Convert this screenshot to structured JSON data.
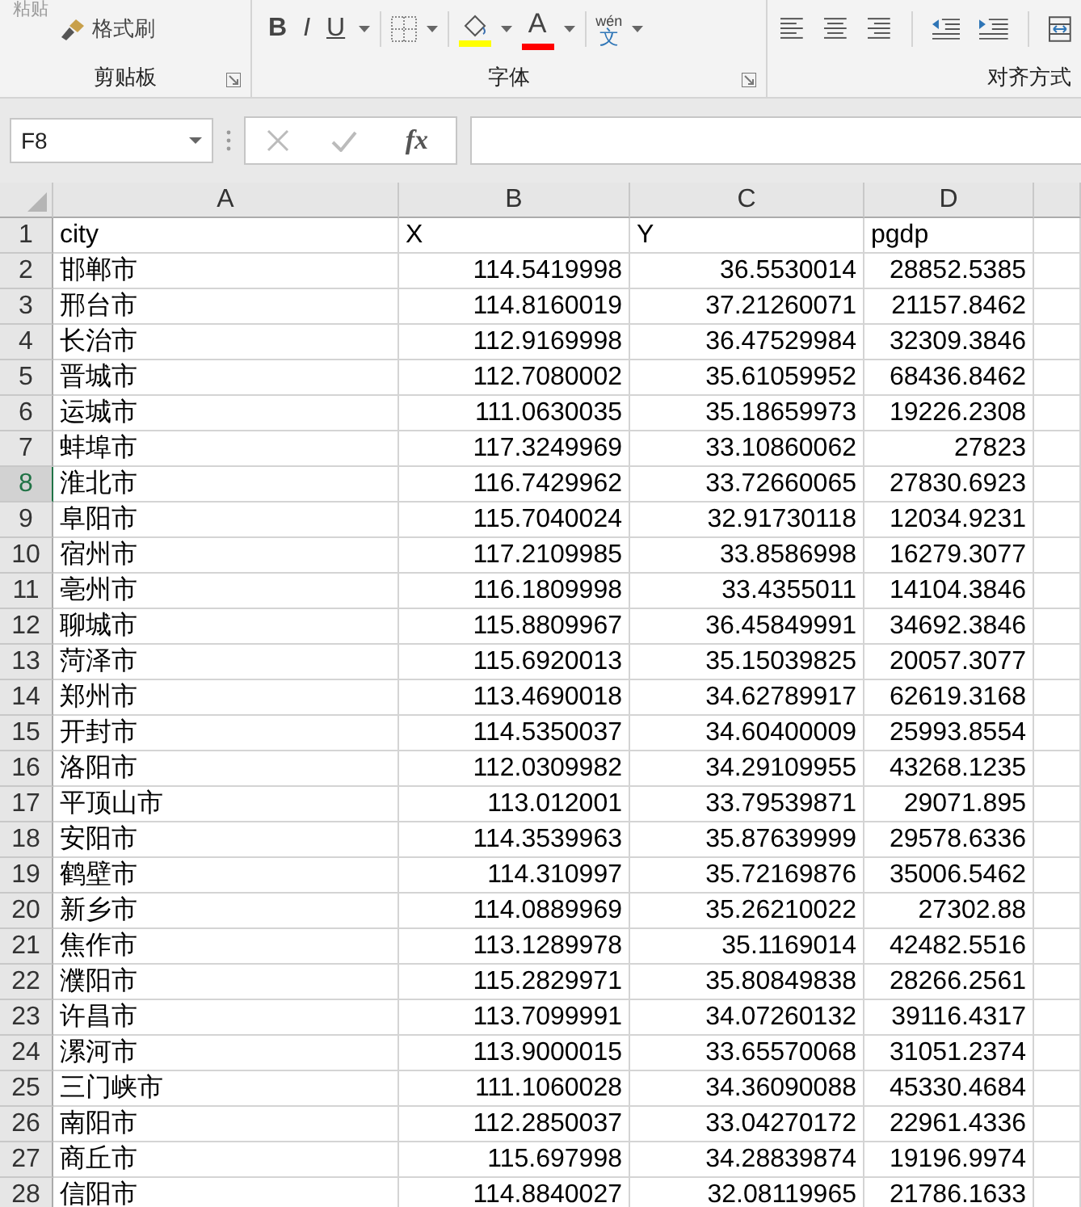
{
  "ribbon": {
    "clipboard": {
      "paste_label": "粘贴",
      "format_painter": "格式刷",
      "group_label": "剪贴板"
    },
    "font": {
      "bold": "B",
      "italic": "I",
      "underline": "U",
      "font_color": "A",
      "phonetic_top": "wén",
      "phonetic_char": "文",
      "group_label": "字体"
    },
    "alignment": {
      "group_label": "对齐方式"
    }
  },
  "formula_bar": {
    "name_box": "F8",
    "function_label": "fx"
  },
  "sheet": {
    "columns": [
      "A",
      "B",
      "C",
      "D"
    ],
    "rows": [
      {
        "number": "1",
        "selected": false,
        "kind": "labels",
        "cells": [
          "city",
          "X",
          "Y",
          "pgdp"
        ]
      },
      {
        "number": "2",
        "selected": false,
        "kind": "values",
        "cells": [
          "邯郸市",
          "114.5419998",
          "36.5530014",
          "28852.5385"
        ]
      },
      {
        "number": "3",
        "selected": false,
        "kind": "values",
        "cells": [
          "邢台市",
          "114.8160019",
          "37.21260071",
          "21157.8462"
        ]
      },
      {
        "number": "4",
        "selected": false,
        "kind": "values",
        "cells": [
          "长治市",
          "112.9169998",
          "36.47529984",
          "32309.3846"
        ]
      },
      {
        "number": "5",
        "selected": false,
        "kind": "values",
        "cells": [
          "晋城市",
          "112.7080002",
          "35.61059952",
          "68436.8462"
        ]
      },
      {
        "number": "6",
        "selected": false,
        "kind": "values",
        "cells": [
          "运城市",
          "111.0630035",
          "35.18659973",
          "19226.2308"
        ]
      },
      {
        "number": "7",
        "selected": false,
        "kind": "values",
        "cells": [
          "蚌埠市",
          "117.3249969",
          "33.10860062",
          "27823"
        ]
      },
      {
        "number": "8",
        "selected": true,
        "kind": "values",
        "cells": [
          "淮北市",
          "116.7429962",
          "33.72660065",
          "27830.6923"
        ]
      },
      {
        "number": "9",
        "selected": false,
        "kind": "values",
        "cells": [
          "阜阳市",
          "115.7040024",
          "32.91730118",
          "12034.9231"
        ]
      },
      {
        "number": "10",
        "selected": false,
        "kind": "values",
        "cells": [
          "宿州市",
          "117.2109985",
          "33.8586998",
          "16279.3077"
        ]
      },
      {
        "number": "11",
        "selected": false,
        "kind": "values",
        "cells": [
          "亳州市",
          "116.1809998",
          "33.4355011",
          "14104.3846"
        ]
      },
      {
        "number": "12",
        "selected": false,
        "kind": "values",
        "cells": [
          "聊城市",
          "115.8809967",
          "36.45849991",
          "34692.3846"
        ]
      },
      {
        "number": "13",
        "selected": false,
        "kind": "values",
        "cells": [
          "菏泽市",
          "115.6920013",
          "35.15039825",
          "20057.3077"
        ]
      },
      {
        "number": "14",
        "selected": false,
        "kind": "values",
        "cells": [
          "郑州市",
          "113.4690018",
          "34.62789917",
          "62619.3168"
        ]
      },
      {
        "number": "15",
        "selected": false,
        "kind": "values",
        "cells": [
          "开封市",
          "114.5350037",
          "34.60400009",
          "25993.8554"
        ]
      },
      {
        "number": "16",
        "selected": false,
        "kind": "values",
        "cells": [
          "洛阳市",
          "112.0309982",
          "34.29109955",
          "43268.1235"
        ]
      },
      {
        "number": "17",
        "selected": false,
        "kind": "values",
        "cells": [
          "平顶山市",
          "113.012001",
          "33.79539871",
          "29071.895"
        ]
      },
      {
        "number": "18",
        "selected": false,
        "kind": "values",
        "cells": [
          "安阳市",
          "114.3539963",
          "35.87639999",
          "29578.6336"
        ]
      },
      {
        "number": "19",
        "selected": false,
        "kind": "values",
        "cells": [
          "鹤壁市",
          "114.310997",
          "35.72169876",
          "35006.5462"
        ]
      },
      {
        "number": "20",
        "selected": false,
        "kind": "values",
        "cells": [
          "新乡市",
          "114.0889969",
          "35.26210022",
          "27302.88"
        ]
      },
      {
        "number": "21",
        "selected": false,
        "kind": "values",
        "cells": [
          "焦作市",
          "113.1289978",
          "35.1169014",
          "42482.5516"
        ]
      },
      {
        "number": "22",
        "selected": false,
        "kind": "values",
        "cells": [
          "濮阳市",
          "115.2829971",
          "35.80849838",
          "28266.2561"
        ]
      },
      {
        "number": "23",
        "selected": false,
        "kind": "values",
        "cells": [
          "许昌市",
          "113.7099991",
          "34.07260132",
          "39116.4317"
        ]
      },
      {
        "number": "24",
        "selected": false,
        "kind": "values",
        "cells": [
          "漯河市",
          "113.9000015",
          "33.65570068",
          "31051.2374"
        ]
      },
      {
        "number": "25",
        "selected": false,
        "kind": "values",
        "cells": [
          "三门峡市",
          "111.1060028",
          "34.36090088",
          "45330.4684"
        ]
      },
      {
        "number": "26",
        "selected": false,
        "kind": "values",
        "cells": [
          "南阳市",
          "112.2850037",
          "33.04270172",
          "22961.4336"
        ]
      },
      {
        "number": "27",
        "selected": false,
        "kind": "values",
        "cells": [
          "商丘市",
          "115.697998",
          "34.28839874",
          "19196.9974"
        ]
      },
      {
        "number": "28",
        "selected": false,
        "kind": "values",
        "cells": [
          "信阳市",
          "114.8840027",
          "32.08119965",
          "21786.1633"
        ]
      }
    ]
  }
}
